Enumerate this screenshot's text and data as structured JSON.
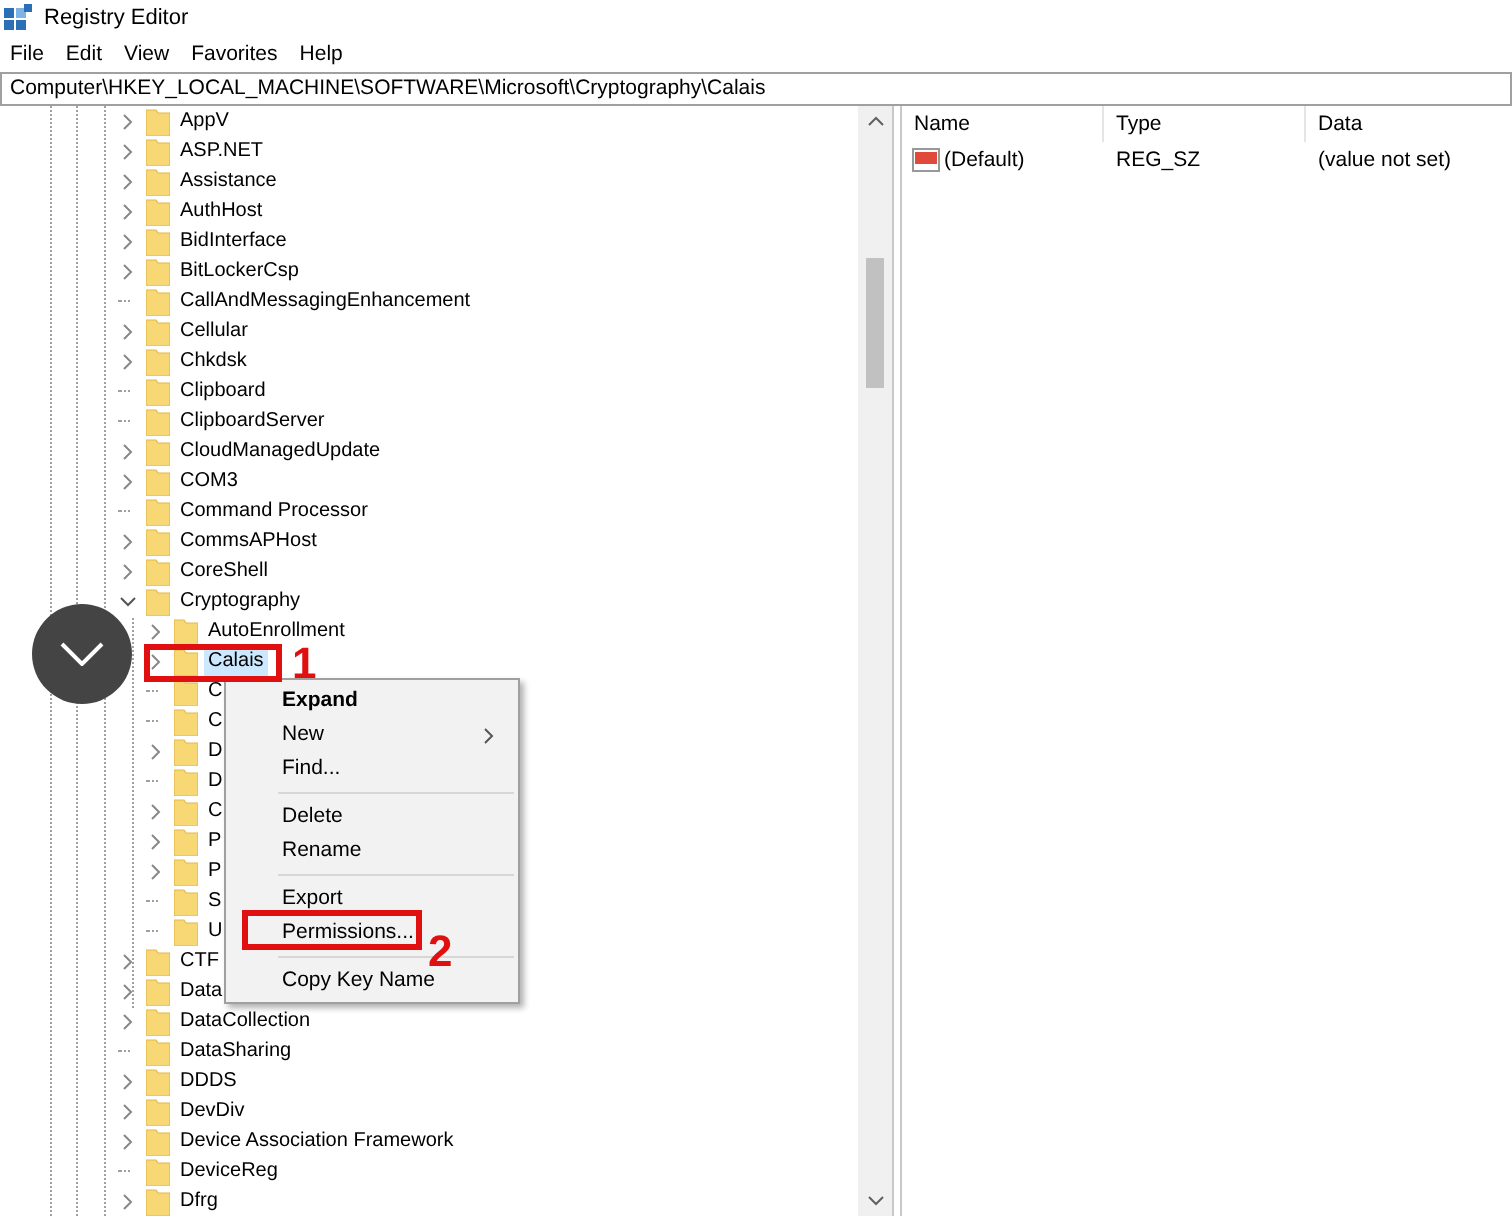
{
  "window": {
    "title": "Registry Editor"
  },
  "menu": [
    "File",
    "Edit",
    "View",
    "Favorites",
    "Help"
  ],
  "address": "Computer\\HKEY_LOCAL_MACHINE\\SOFTWARE\\Microsoft\\Cryptography\\Calais",
  "tree": [
    {
      "label": "AppV",
      "kind": "collapsed",
      "selected": false
    },
    {
      "label": "ASP.NET",
      "kind": "collapsed",
      "selected": false
    },
    {
      "label": "Assistance",
      "kind": "collapsed",
      "selected": false
    },
    {
      "label": "AuthHost",
      "kind": "collapsed",
      "selected": false
    },
    {
      "label": "BidInterface",
      "kind": "collapsed",
      "selected": false
    },
    {
      "label": "BitLockerCsp",
      "kind": "collapsed",
      "selected": false
    },
    {
      "label": "CallAndMessagingEnhancement",
      "kind": "leaf",
      "selected": false
    },
    {
      "label": "Cellular",
      "kind": "collapsed",
      "selected": false
    },
    {
      "label": "Chkdsk",
      "kind": "collapsed",
      "selected": false
    },
    {
      "label": "Clipboard",
      "kind": "leaf",
      "selected": false
    },
    {
      "label": "ClipboardServer",
      "kind": "leaf",
      "selected": false
    },
    {
      "label": "CloudManagedUpdate",
      "kind": "collapsed",
      "selected": false
    },
    {
      "label": "COM3",
      "kind": "collapsed",
      "selected": false
    },
    {
      "label": "Command Processor",
      "kind": "leaf",
      "selected": false
    },
    {
      "label": "CommsAPHost",
      "kind": "collapsed",
      "selected": false
    },
    {
      "label": "CoreShell",
      "kind": "collapsed",
      "selected": false
    },
    {
      "label": "Cryptography",
      "kind": "expanded",
      "selected": false,
      "children": [
        {
          "label": "AutoEnrollment",
          "kind": "collapsed",
          "selected": false
        },
        {
          "label": "Calais",
          "kind": "collapsed",
          "selected": true
        },
        {
          "label": "C",
          "kind": "leaf",
          "selected": false
        },
        {
          "label": "C",
          "kind": "leaf",
          "selected": false
        },
        {
          "label": "D",
          "kind": "collapsed",
          "selected": false
        },
        {
          "label": "D",
          "kind": "leaf",
          "selected": false
        },
        {
          "label": "C",
          "kind": "collapsed",
          "selected": false
        },
        {
          "label": "P",
          "kind": "collapsed",
          "selected": false
        },
        {
          "label": "P",
          "kind": "collapsed",
          "selected": false
        },
        {
          "label": "S",
          "kind": "leaf",
          "selected": false
        },
        {
          "label": "U",
          "kind": "leaf",
          "selected": false
        }
      ]
    },
    {
      "label": "CTF",
      "kind": "collapsed",
      "selected": false
    },
    {
      "label": "Data",
      "kind": "collapsed",
      "selected": false
    },
    {
      "label": "DataCollection",
      "kind": "collapsed",
      "selected": false
    },
    {
      "label": "DataSharing",
      "kind": "leaf",
      "selected": false
    },
    {
      "label": "DDDS",
      "kind": "collapsed",
      "selected": false
    },
    {
      "label": "DevDiv",
      "kind": "collapsed",
      "selected": false
    },
    {
      "label": "Device Association Framework",
      "kind": "collapsed",
      "selected": false
    },
    {
      "label": "DeviceReg",
      "kind": "leaf",
      "selected": false
    },
    {
      "label": "Dfrg",
      "kind": "collapsed",
      "selected": false
    }
  ],
  "values_table": {
    "columns": [
      "Name",
      "Type",
      "Data"
    ],
    "rows": [
      {
        "name": "(Default)",
        "type": "REG_SZ",
        "data": "(value not set)"
      }
    ]
  },
  "context_menu": [
    {
      "kind": "item",
      "label": "Expand",
      "default": true,
      "submenu": false
    },
    {
      "kind": "item",
      "label": "New",
      "default": false,
      "submenu": true
    },
    {
      "kind": "item",
      "label": "Find...",
      "default": false,
      "submenu": false
    },
    {
      "kind": "separator"
    },
    {
      "kind": "item",
      "label": "Delete",
      "default": false,
      "submenu": false
    },
    {
      "kind": "item",
      "label": "Rename",
      "default": false,
      "submenu": false
    },
    {
      "kind": "separator"
    },
    {
      "kind": "item",
      "label": "Export",
      "default": false,
      "submenu": false
    },
    {
      "kind": "item",
      "label": "Permissions...",
      "default": false,
      "submenu": false
    },
    {
      "kind": "separator"
    },
    {
      "kind": "item",
      "label": "Copy Key Name",
      "default": false,
      "submenu": false
    }
  ],
  "annotations": [
    {
      "label": "1"
    },
    {
      "label": "2"
    }
  ]
}
